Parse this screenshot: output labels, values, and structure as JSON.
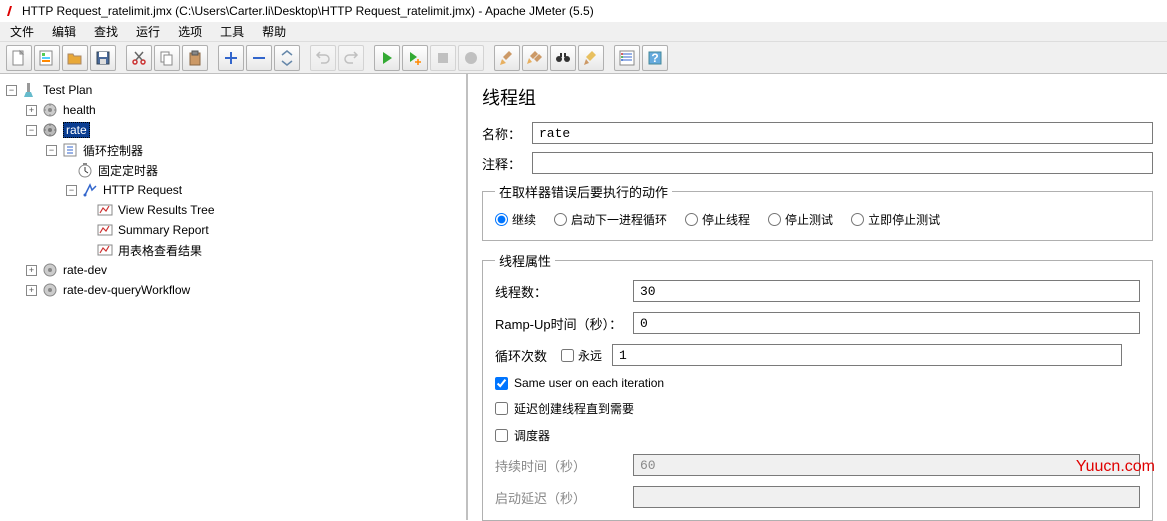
{
  "window": {
    "title": "HTTP Request_ratelimit.jmx (C:\\Users\\Carter.li\\Desktop\\HTTP Request_ratelimit.jmx) - Apache JMeter (5.5)"
  },
  "menu": {
    "file": "文件",
    "edit": "编辑",
    "search": "查找",
    "run": "运行",
    "options": "选项",
    "tools": "工具",
    "help": "帮助"
  },
  "tree": {
    "root": "Test Plan",
    "health": "health",
    "rate": "rate",
    "loop_controller": "循环控制器",
    "fixed_timer": "固定定时器",
    "http_request": "HTTP Request",
    "view_results_tree": "View Results Tree",
    "summary_report": "Summary Report",
    "table_report": "用表格查看结果",
    "rate_dev": "rate-dev",
    "rate_dev_query": "rate-dev-queryWorkflow"
  },
  "panel": {
    "title": "线程组",
    "name_label": "名称：",
    "name_value": "rate",
    "comment_label": "注释：",
    "comment_value": "",
    "error_legend": "在取样器错误后要执行的动作",
    "radio_continue": "继续",
    "radio_next_loop": "启动下一进程循环",
    "radio_stop_thread": "停止线程",
    "radio_stop_test": "停止测试",
    "radio_stop_now": "立即停止测试",
    "thread_legend": "线程属性",
    "threads_label": "线程数：",
    "threads_value": "30",
    "rampup_label": "Ramp-Up时间（秒）：",
    "rampup_value": "0",
    "loop_label": "循环次数",
    "loop_forever": "永远",
    "loop_value": "1",
    "same_user": "Same user on each iteration",
    "delay_create": "延迟创建线程直到需要",
    "scheduler": "调度器",
    "duration_label": "持续时间（秒）",
    "duration_value": "60",
    "startup_delay_label": "启动延迟（秒）",
    "startup_delay_value": ""
  },
  "watermark": "Yuucn.com"
}
